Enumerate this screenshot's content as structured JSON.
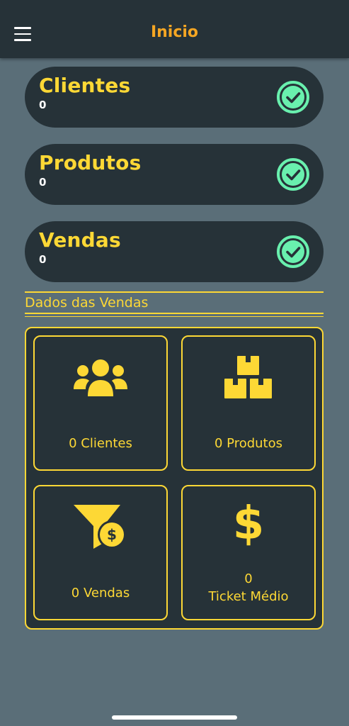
{
  "header": {
    "title": "Inicio",
    "menu_icon": "hamburger-menu-icon"
  },
  "summary": [
    {
      "label": "Clientes",
      "count": "0",
      "icon": "check-circle-icon"
    },
    {
      "label": "Produtos",
      "count": "0",
      "icon": "check-circle-icon"
    },
    {
      "label": "Vendas",
      "count": "0",
      "icon": "check-circle-icon"
    }
  ],
  "section": {
    "title": "Dados das Vendas"
  },
  "cards": [
    {
      "label": "0 Clientes",
      "icon": "users-icon"
    },
    {
      "label": "0 Produtos",
      "icon": "boxes-icon"
    },
    {
      "label": "0 Vendas",
      "icon": "funnel-dollar-icon"
    },
    {
      "value": "0",
      "label": "Ticket Médio",
      "icon": "dollar-icon"
    }
  ],
  "colors": {
    "background": "#5a6e78",
    "surface": "#263238",
    "accent": "#fdd835",
    "title": "#f5a623",
    "check": "#69f0ae"
  }
}
